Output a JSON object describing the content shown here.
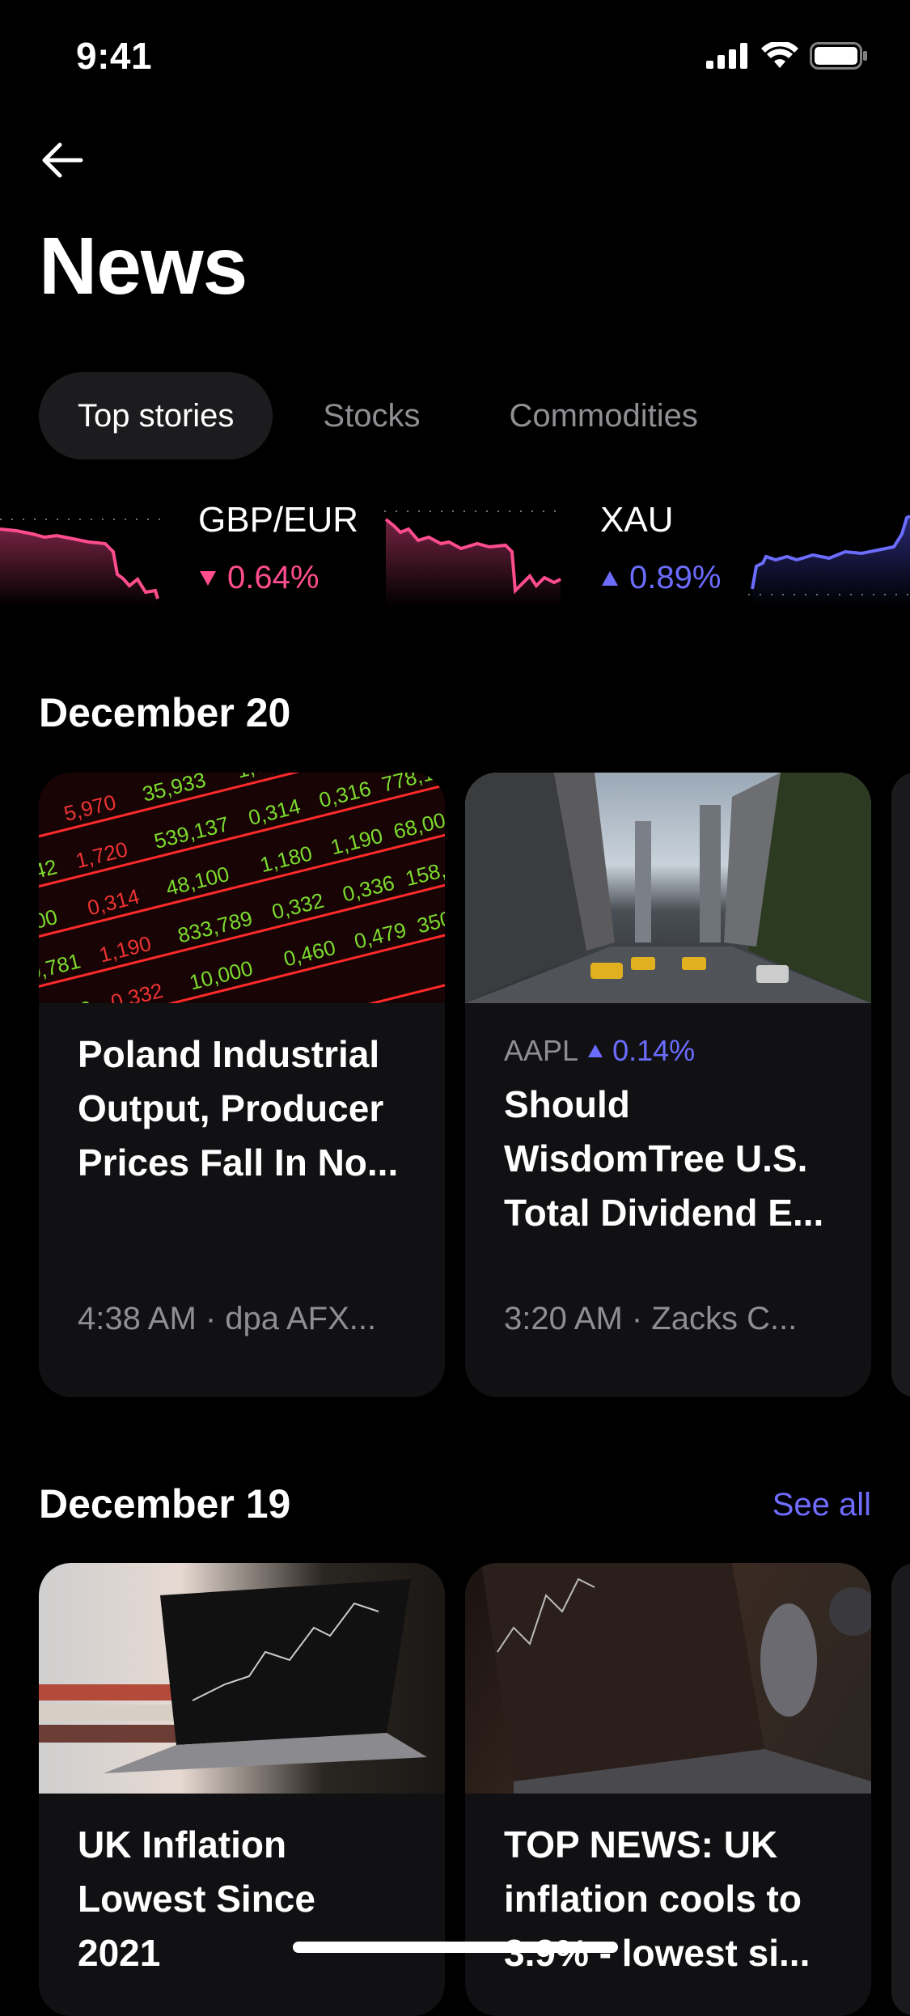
{
  "status_bar": {
    "time": "9:41"
  },
  "header": {
    "title": "News"
  },
  "tabs": [
    {
      "label": "Top stories",
      "active": true
    },
    {
      "label": "Stocks",
      "active": false
    },
    {
      "label": "Commodities",
      "active": false
    }
  ],
  "tickers": [
    {
      "symbol": "GBP/EUR",
      "change": "0.64%",
      "direction": "down",
      "color": "#ff4d8d"
    },
    {
      "symbol": "XAU",
      "change": "0.89%",
      "direction": "up",
      "color": "#6c6cff"
    }
  ],
  "sections": [
    {
      "title": "December 20",
      "cards": [
        {
          "headline": "Poland Industrial Output, Producer Prices Fall In No...",
          "meta": "4:38 AM · dpa AFX...",
          "image": "stock-board"
        },
        {
          "ticker": "AAPL",
          "ticker_change": "0.14%",
          "ticker_direction": "up",
          "headline": "Should WisdomTree U.S. Total Dividend E...",
          "meta": "3:20 AM · Zacks C...",
          "image": "city-street"
        }
      ]
    },
    {
      "title": "December 19",
      "see_all": "See all",
      "cards": [
        {
          "headline": "UK Inflation Lowest Since 2021",
          "image": "laptop-chart"
        },
        {
          "headline": "TOP NEWS: UK inflation cools to 3.9% - lowest si...",
          "image": "laptop-desk"
        }
      ]
    }
  ],
  "colors": {
    "accent": "#6f6cff",
    "negative": "#ff4d8d",
    "positive": "#6c6cff",
    "card_bg": "#111114"
  }
}
